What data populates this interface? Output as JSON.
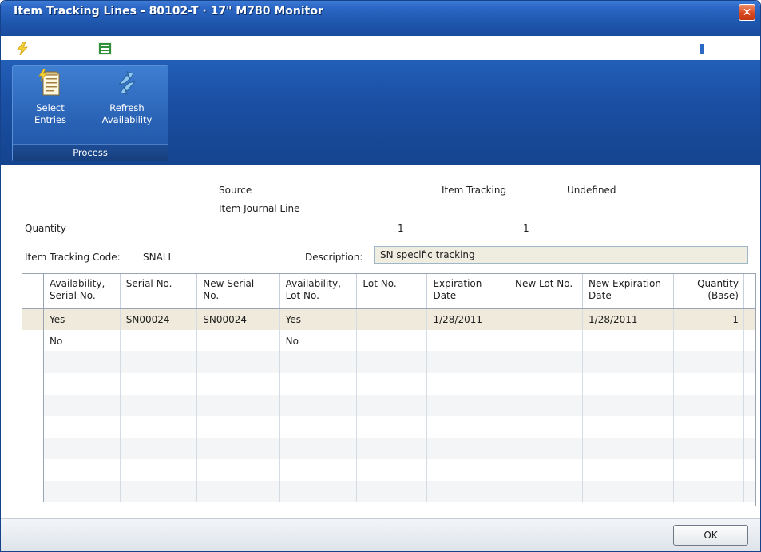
{
  "window": {
    "title": "Item Tracking Lines - 80102-T · 17\" M780 Monitor",
    "close_glyph": "✕"
  },
  "menu": {
    "actions_label": "Actions",
    "related_label": "Related Information",
    "help_glyph": "?"
  },
  "ribbon": {
    "group_label": "Process",
    "buttons": [
      {
        "label_line1": "Select",
        "label_line2": "Entries",
        "icon": "select-entries-icon"
      },
      {
        "label_line1": "Refresh",
        "label_line2": "Availability",
        "icon": "refresh-availability-icon"
      }
    ]
  },
  "header": {
    "source_label": "Source",
    "source_value": "Item Journal Line",
    "item_tracking_label": "Item Tracking",
    "item_tracking_value": "Undefined",
    "quantity_label": "Quantity",
    "quantity_source": "1",
    "quantity_tracking": "1",
    "item_tracking_code_label": "Item Tracking Code:",
    "item_tracking_code_value": "SNALL",
    "description_label": "Description:",
    "description_value": "SN specific tracking"
  },
  "grid": {
    "columns": [
      {
        "line1": "Availability,",
        "line2": "Serial No."
      },
      {
        "line1": "Serial No.",
        "line2": ""
      },
      {
        "line1": "New Serial",
        "line2": "No."
      },
      {
        "line1": "Availability,",
        "line2": "Lot No."
      },
      {
        "line1": "Lot No.",
        "line2": ""
      },
      {
        "line1": "Expiration",
        "line2": "Date"
      },
      {
        "line1": "New Lot No.",
        "line2": ""
      },
      {
        "line1": "New Expiration",
        "line2": "Date"
      },
      {
        "line1": "Quantity",
        "line2": "(Base)"
      }
    ],
    "rows": [
      [
        "Yes",
        "SN00024",
        "SN00024",
        "Yes",
        "",
        "1/28/2011",
        "",
        "1/28/2011",
        "1"
      ],
      [
        "No",
        "",
        "",
        "No",
        "",
        "",
        "",
        "",
        ""
      ]
    ]
  },
  "footer": {
    "ok_label": "OK"
  },
  "colors": {
    "title_bar": "#1f57ae",
    "ribbon": "#1a4fa3",
    "selected_row": "#efeadc",
    "description_field": "#efede0"
  }
}
